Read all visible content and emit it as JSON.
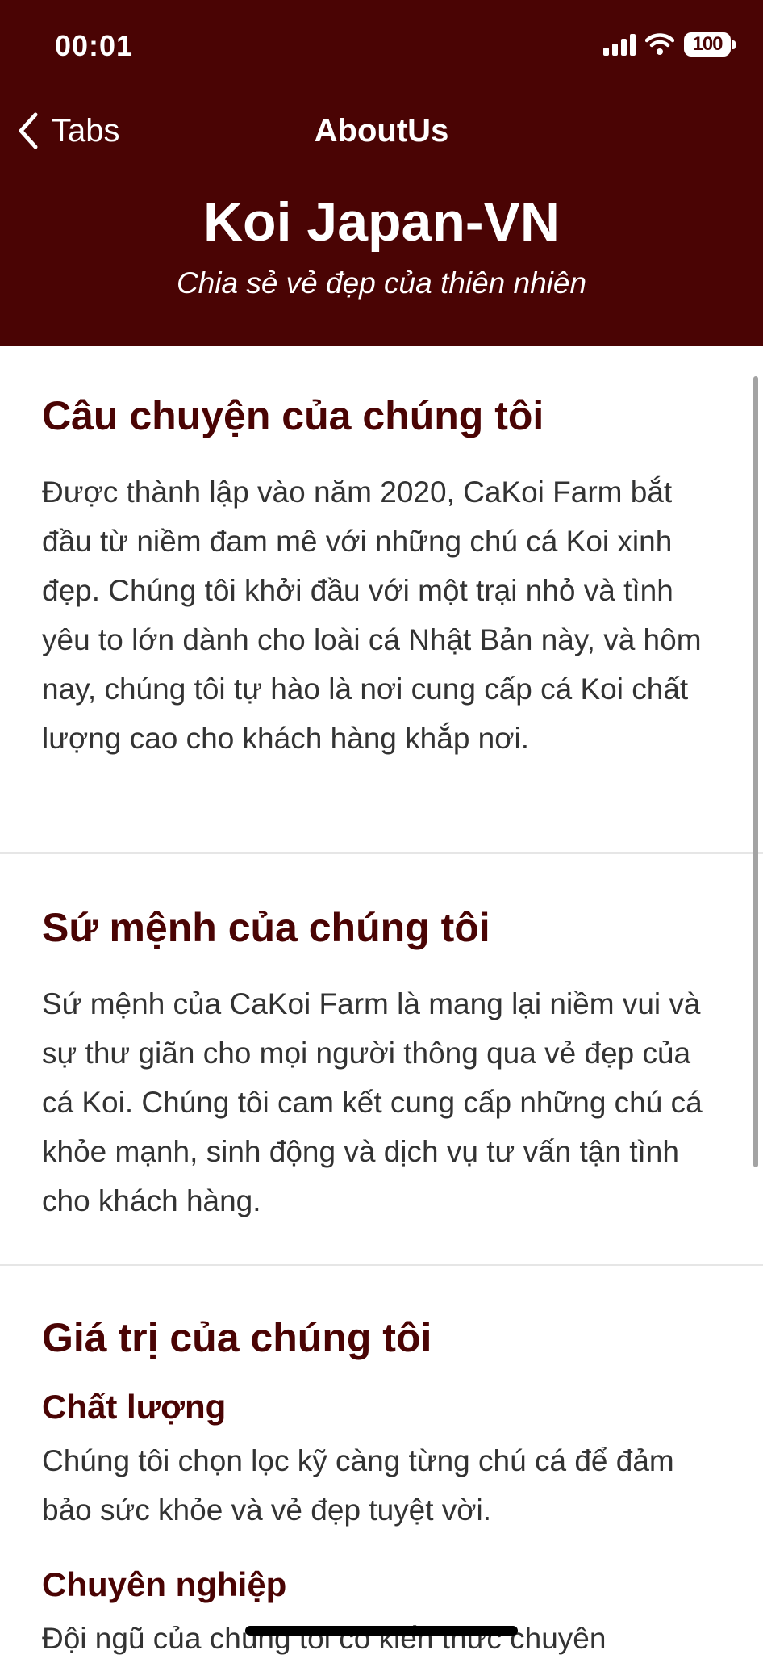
{
  "status_bar": {
    "time": "00:01",
    "battery": "100",
    "icons": [
      "signal-icon",
      "wifi-icon",
      "battery-icon"
    ]
  },
  "nav": {
    "back_label": "Tabs",
    "title": "AboutUs"
  },
  "brand": {
    "title": "Koi Japan-VN",
    "tagline": "Chia sẻ vẻ đẹp của thiên nhiên"
  },
  "sections": {
    "story": {
      "heading": "Câu chuyện của chúng tôi",
      "body": "Được thành lập vào năm 2020, CaKoi Farm bắt đầu từ niềm đam mê với những chú cá Koi xinh đẹp. Chúng tôi khởi đầu với một trại nhỏ và tình yêu to lớn dành cho loài cá Nhật Bản này, và hôm nay, chúng tôi tự hào là nơi cung cấp cá Koi chất lượng cao cho khách hàng khắp nơi."
    },
    "mission": {
      "heading": "Sứ mệnh của chúng tôi",
      "body": "Sứ mệnh của CaKoi Farm là mang lại niềm vui và sự thư giãn cho mọi người thông qua vẻ đẹp của cá Koi. Chúng tôi cam kết cung cấp những chú cá khỏe mạnh, sinh động và dịch vụ tư vấn tận tình cho khách hàng."
    },
    "values": {
      "heading": "Giá trị của chúng tôi",
      "items": [
        {
          "title": "Chất lượng",
          "body": "Chúng tôi chọn lọc kỹ càng từng chú cá để đảm bảo sức khỏe và vẻ đẹp tuyệt vời."
        },
        {
          "title": "Chuyên nghiệp",
          "body": "Đội ngũ của chúng tôi có kiến thức chuyên"
        }
      ]
    }
  },
  "colors": {
    "header_bg": "#4a0404",
    "heading": "#4a0404",
    "body_text": "#333333",
    "divider": "#e6e6e6"
  }
}
